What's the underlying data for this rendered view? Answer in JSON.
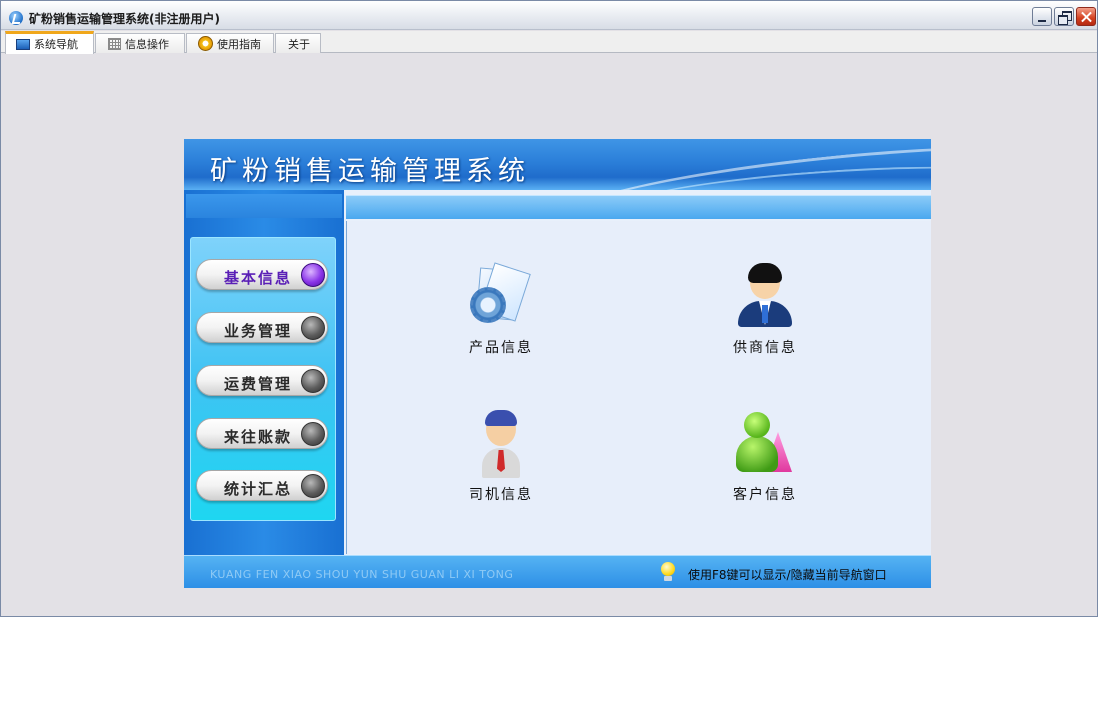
{
  "window": {
    "title": "矿粉销售运输管理系统(非注册用户)"
  },
  "tabs": [
    {
      "label": "系统导航",
      "icon": "monitor-icon",
      "active": true
    },
    {
      "label": "信息操作",
      "icon": "grid-icon",
      "active": false
    },
    {
      "label": "使用指南",
      "icon": "help-icon",
      "active": false
    },
    {
      "label": "关于",
      "icon": "",
      "active": false
    }
  ],
  "banner": {
    "title": "矿粉销售运输管理系统"
  },
  "menu": {
    "items": [
      {
        "label": "基本信息",
        "active": true
      },
      {
        "label": "业务管理",
        "active": false
      },
      {
        "label": "运费管理",
        "active": false
      },
      {
        "label": "来往账款",
        "active": false
      },
      {
        "label": "统计汇总",
        "active": false
      }
    ]
  },
  "content": {
    "items": [
      {
        "label": "产品信息",
        "icon": "product-info-icon"
      },
      {
        "label": "供商信息",
        "icon": "supplier-info-icon"
      },
      {
        "label": "司机信息",
        "icon": "driver-info-icon"
      },
      {
        "label": "客户信息",
        "icon": "customer-info-icon"
      }
    ]
  },
  "footer": {
    "pinyin": "KUANG FEN XIAO SHOU YUN SHU GUAN LI XI TONG",
    "tip": "使用F8键可以显示/隐藏当前导航窗口"
  },
  "colors": {
    "accent": "#1f6ccb",
    "active_tab": "#f0a71b",
    "active_menu_text": "#5a1fb6"
  }
}
